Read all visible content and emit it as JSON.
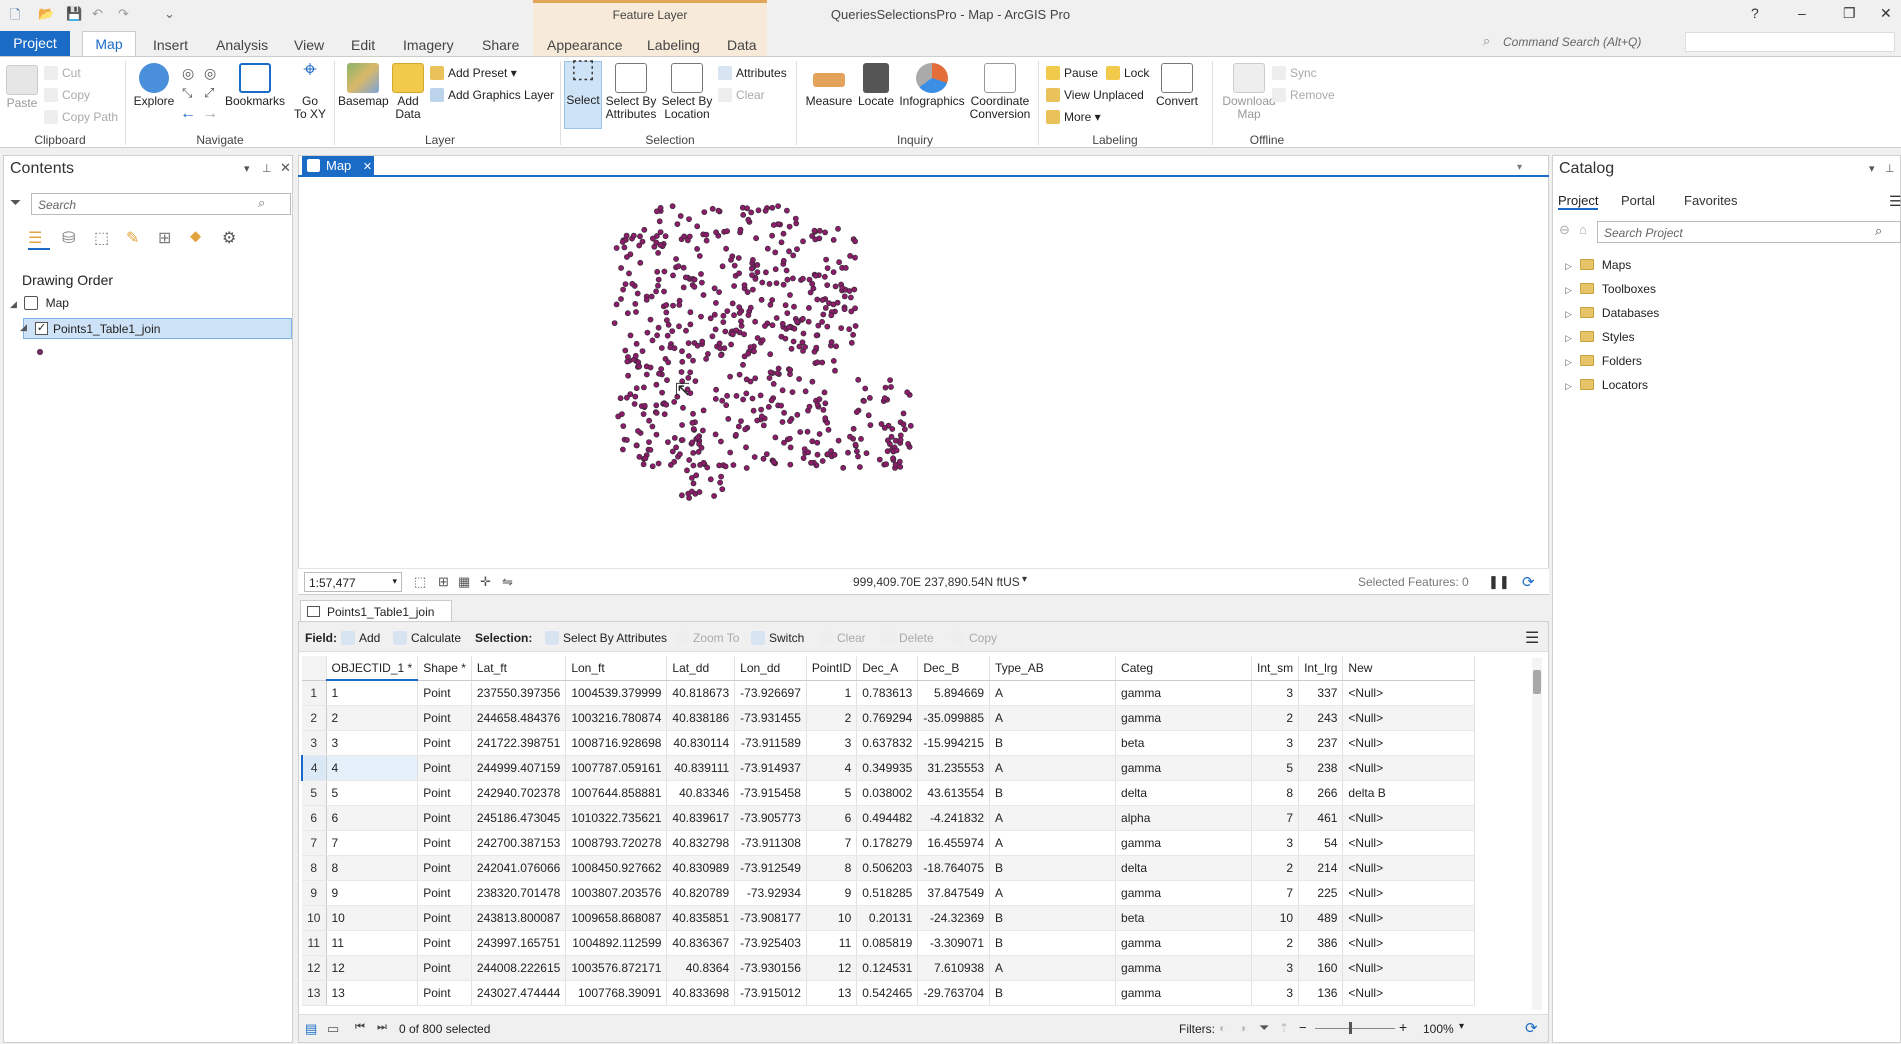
{
  "window": {
    "title": "QueriesSelectionsPro - Map - ArcGIS Pro",
    "context_group": "Feature Layer",
    "help": "?",
    "min": "–",
    "restore": "❐",
    "close": "✕"
  },
  "tabs": [
    "Project",
    "Map",
    "Insert",
    "Analysis",
    "View",
    "Edit",
    "Imagery",
    "Share",
    "Appearance",
    "Labeling",
    "Data"
  ],
  "command_search": "Command Search (Alt+Q)",
  "ribbon": {
    "clipboard": {
      "label": "Clipboard",
      "paste": "Paste",
      "cut": "Cut",
      "copy": "Copy",
      "copy_path": "Copy Path"
    },
    "navigate": {
      "label": "Navigate",
      "explore": "Explore",
      "bookmarks": "Bookmarks",
      "goto": "Go\nTo XY"
    },
    "layer": {
      "label": "Layer",
      "basemap": "Basemap",
      "add_data": "Add\nData",
      "add_preset": "Add Preset",
      "add_graphics": "Add Graphics Layer"
    },
    "selection": {
      "label": "Selection",
      "select": "Select",
      "select_by_attr": "Select By\nAttributes",
      "select_by_loc": "Select By\nLocation",
      "attributes": "Attributes",
      "clear": "Clear"
    },
    "inquiry": {
      "label": "Inquiry",
      "measure": "Measure",
      "locate": "Locate",
      "infographics": "Infographics",
      "coord_conv": "Coordinate\nConversion"
    },
    "labeling": {
      "label": "Labeling",
      "pause": "Pause",
      "lock": "Lock",
      "view_unplaced": "View Unplaced",
      "more": "More",
      "convert": "Convert"
    },
    "offline": {
      "label": "Offline",
      "download_map": "Download\nMap",
      "sync": "Sync",
      "remove": "Remove"
    }
  },
  "contents": {
    "title": "Contents",
    "search_placeholder": "Search",
    "drawing_order": "Drawing Order",
    "map_item": "Map",
    "layer_item": "Points1_Table1_join"
  },
  "map": {
    "tab": "Map",
    "scale": "1:57,477",
    "coords": "999,409.70E 237,890.54N ftUS",
    "selected_features": "Selected Features: 0",
    "point_color": "#8b1d6b"
  },
  "catalog": {
    "title": "Catalog",
    "tabs": [
      "Project",
      "Portal",
      "Favorites"
    ],
    "search_placeholder": "Search Project",
    "items": [
      "Maps",
      "Toolboxes",
      "Databases",
      "Styles",
      "Folders",
      "Locators"
    ]
  },
  "table": {
    "tab": "Points1_Table1_join",
    "toolbar": {
      "field": "Field:",
      "add": "Add",
      "calculate": "Calculate",
      "selection": "Selection:",
      "select_by_attr": "Select By Attributes",
      "zoom_to": "Zoom To",
      "switch": "Switch",
      "clear": "Clear",
      "delete": "Delete",
      "copy": "Copy"
    },
    "columns": [
      "OBJECTID_1 *",
      "Shape *",
      "Lat_ft",
      "Lon_ft",
      "Lat_dd",
      "Lon_dd",
      "PointID",
      "Dec_A",
      "Dec_B",
      "Type_AB",
      "Categ",
      "Int_sm",
      "Int_lrg",
      "New"
    ],
    "rows": [
      [
        "1",
        "Point",
        "237550.397356",
        "1004539.379999",
        "40.818673",
        "-73.926697",
        "1",
        "0.783613",
        "5.894669",
        "A",
        "gamma",
        "3",
        "337",
        "<Null>"
      ],
      [
        "2",
        "Point",
        "244658.484376",
        "1003216.780874",
        "40.838186",
        "-73.931455",
        "2",
        "0.769294",
        "-35.099885",
        "A",
        "gamma",
        "2",
        "243",
        "<Null>"
      ],
      [
        "3",
        "Point",
        "241722.398751",
        "1008716.928698",
        "40.830114",
        "-73.911589",
        "3",
        "0.637832",
        "-15.994215",
        "B",
        "beta",
        "3",
        "237",
        "<Null>"
      ],
      [
        "4",
        "Point",
        "244999.407159",
        "1007787.059161",
        "40.839111",
        "-73.914937",
        "4",
        "0.349935",
        "31.235553",
        "A",
        "gamma",
        "5",
        "238",
        "<Null>"
      ],
      [
        "5",
        "Point",
        "242940.702378",
        "1007644.858881",
        "40.83346",
        "-73.915458",
        "5",
        "0.038002",
        "43.613554",
        "B",
        "delta",
        "8",
        "266",
        "delta B"
      ],
      [
        "6",
        "Point",
        "245186.473045",
        "1010322.735621",
        "40.839617",
        "-73.905773",
        "6",
        "0.494482",
        "-4.241832",
        "A",
        "alpha",
        "7",
        "461",
        "<Null>"
      ],
      [
        "7",
        "Point",
        "242700.387153",
        "1008793.720278",
        "40.832798",
        "-73.911308",
        "7",
        "0.178279",
        "16.455974",
        "A",
        "gamma",
        "3",
        "54",
        "<Null>"
      ],
      [
        "8",
        "Point",
        "242041.076066",
        "1008450.927662",
        "40.830989",
        "-73.912549",
        "8",
        "0.506203",
        "-18.764075",
        "B",
        "delta",
        "2",
        "214",
        "<Null>"
      ],
      [
        "9",
        "Point",
        "238320.701478",
        "1003807.203576",
        "40.820789",
        "-73.92934",
        "9",
        "0.518285",
        "37.847549",
        "A",
        "gamma",
        "7",
        "225",
        "<Null>"
      ],
      [
        "10",
        "Point",
        "243813.800087",
        "1009658.868087",
        "40.835851",
        "-73.908177",
        "10",
        "0.20131",
        "-24.32369",
        "B",
        "beta",
        "10",
        "489",
        "<Null>"
      ],
      [
        "11",
        "Point",
        "243997.165751",
        "1004892.112599",
        "40.836367",
        "-73.925403",
        "11",
        "0.085819",
        "-3.309071",
        "B",
        "gamma",
        "2",
        "386",
        "<Null>"
      ],
      [
        "12",
        "Point",
        "244008.222615",
        "1003576.872171",
        "40.8364",
        "-73.930156",
        "12",
        "0.124531",
        "7.610938",
        "A",
        "gamma",
        "3",
        "160",
        "<Null>"
      ],
      [
        "13",
        "Point",
        "243027.474444",
        "1007768.39091",
        "40.833698",
        "-73.915012",
        "13",
        "0.542465",
        "-29.763704",
        "B",
        "gamma",
        "3",
        "136",
        "<Null>"
      ]
    ],
    "footer": {
      "selected": "0 of 800 selected",
      "filters": "Filters:",
      "zoom": "100%"
    }
  }
}
